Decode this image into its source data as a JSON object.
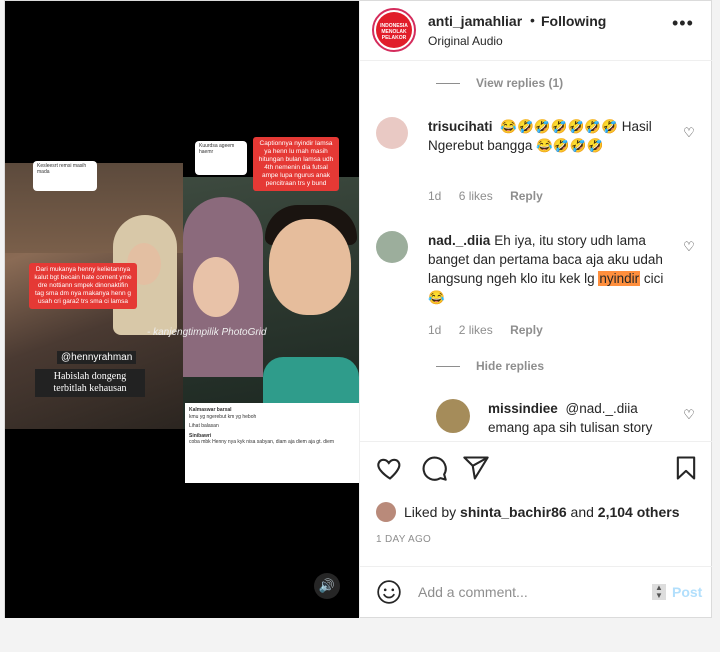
{
  "media": {
    "note_left": "Dari mukanya henny kelietannya kalut bgt becain hate coment yme dre nottiann smpek dinonaktifin tag sma dm nya makanya henn g usah cri gara2 trs sma ci lamsa",
    "note_right": "Captionnya nyindir lamsa ya henn lu mah masih hitungan bulan lamsa udh 4th nemenin dia futsal ampe lupa ngurus anak pencitraan trs y bund",
    "bubble_left": "Kesleesrt remsi masih mada",
    "bubble_right": "Kuurdsa ageem haemr",
    "watermark": "- kanjengtimpilik PhotoGrid",
    "handle_tag": "@hennyrahman",
    "caption_tag": "Habislah dongeng terbitlah kehausan",
    "comment_shot": [
      {
        "user": "Kalmaswar barxal",
        "text": "kmu yg ngerebut km yg heboh"
      },
      {
        "user": "Lihat balasan",
        "text": ""
      },
      {
        "user": "Sinibawri",
        "text": "coba mbk Henny nya kyk nisa sabyan, diam aja diem aja gt. diem"
      }
    ]
  },
  "post": {
    "username": "anti_jamahliar",
    "separator": "•",
    "follow_status": "Following",
    "audio": "Original Audio",
    "avatar_text": "INDONESIA MENOLAK PELAKOR"
  },
  "comments": {
    "view_replies_top": "View replies (1)",
    "items": [
      {
        "user": "trisucihati",
        "text": "😂🤣🤣🤣🤣🤣🤣 Hasil Ngerebut bangga 😂🤣🤣🤣",
        "time": "1d",
        "likes": "6 likes",
        "reply": "Reply",
        "avatar_color": "#e9c9c4"
      },
      {
        "user": "nad._.diia",
        "text_before": "Eh iya, itu story udh lama banget dan pertama baca aja aku udah langsung ngeh klo itu kek lg ",
        "highlight": "nyindir",
        "text_after": " cici 😂",
        "time": "1d",
        "likes": "2 likes",
        "reply": "Reply",
        "avatar_color": "#9cae9c"
      }
    ],
    "hide_replies": "Hide replies",
    "reply_item": {
      "user": "missindiee",
      "text": "@nad._.diia emang apa sih tulisan story",
      "avatar_color": "#a58c5a"
    }
  },
  "actions": {
    "liked_prefix": "Liked by ",
    "liked_user": "shinta_bachir86",
    "liked_and": " and ",
    "liked_others": "2,104 others",
    "date": "1 DAY AGO"
  },
  "add_comment": {
    "placeholder": "Add a comment...",
    "post_label": "Post"
  }
}
